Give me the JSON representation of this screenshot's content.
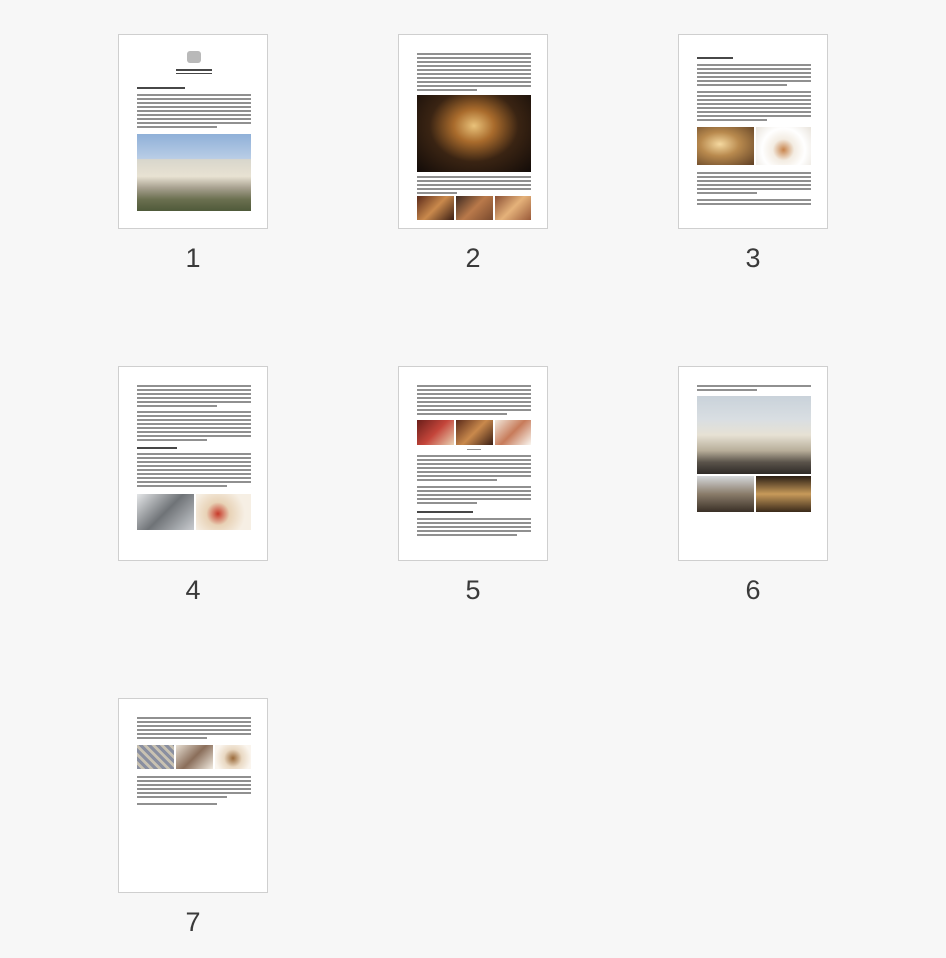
{
  "pages": [
    {
      "number": "1"
    },
    {
      "number": "2"
    },
    {
      "number": "3"
    },
    {
      "number": "4"
    },
    {
      "number": "5"
    },
    {
      "number": "6"
    },
    {
      "number": "7"
    }
  ]
}
